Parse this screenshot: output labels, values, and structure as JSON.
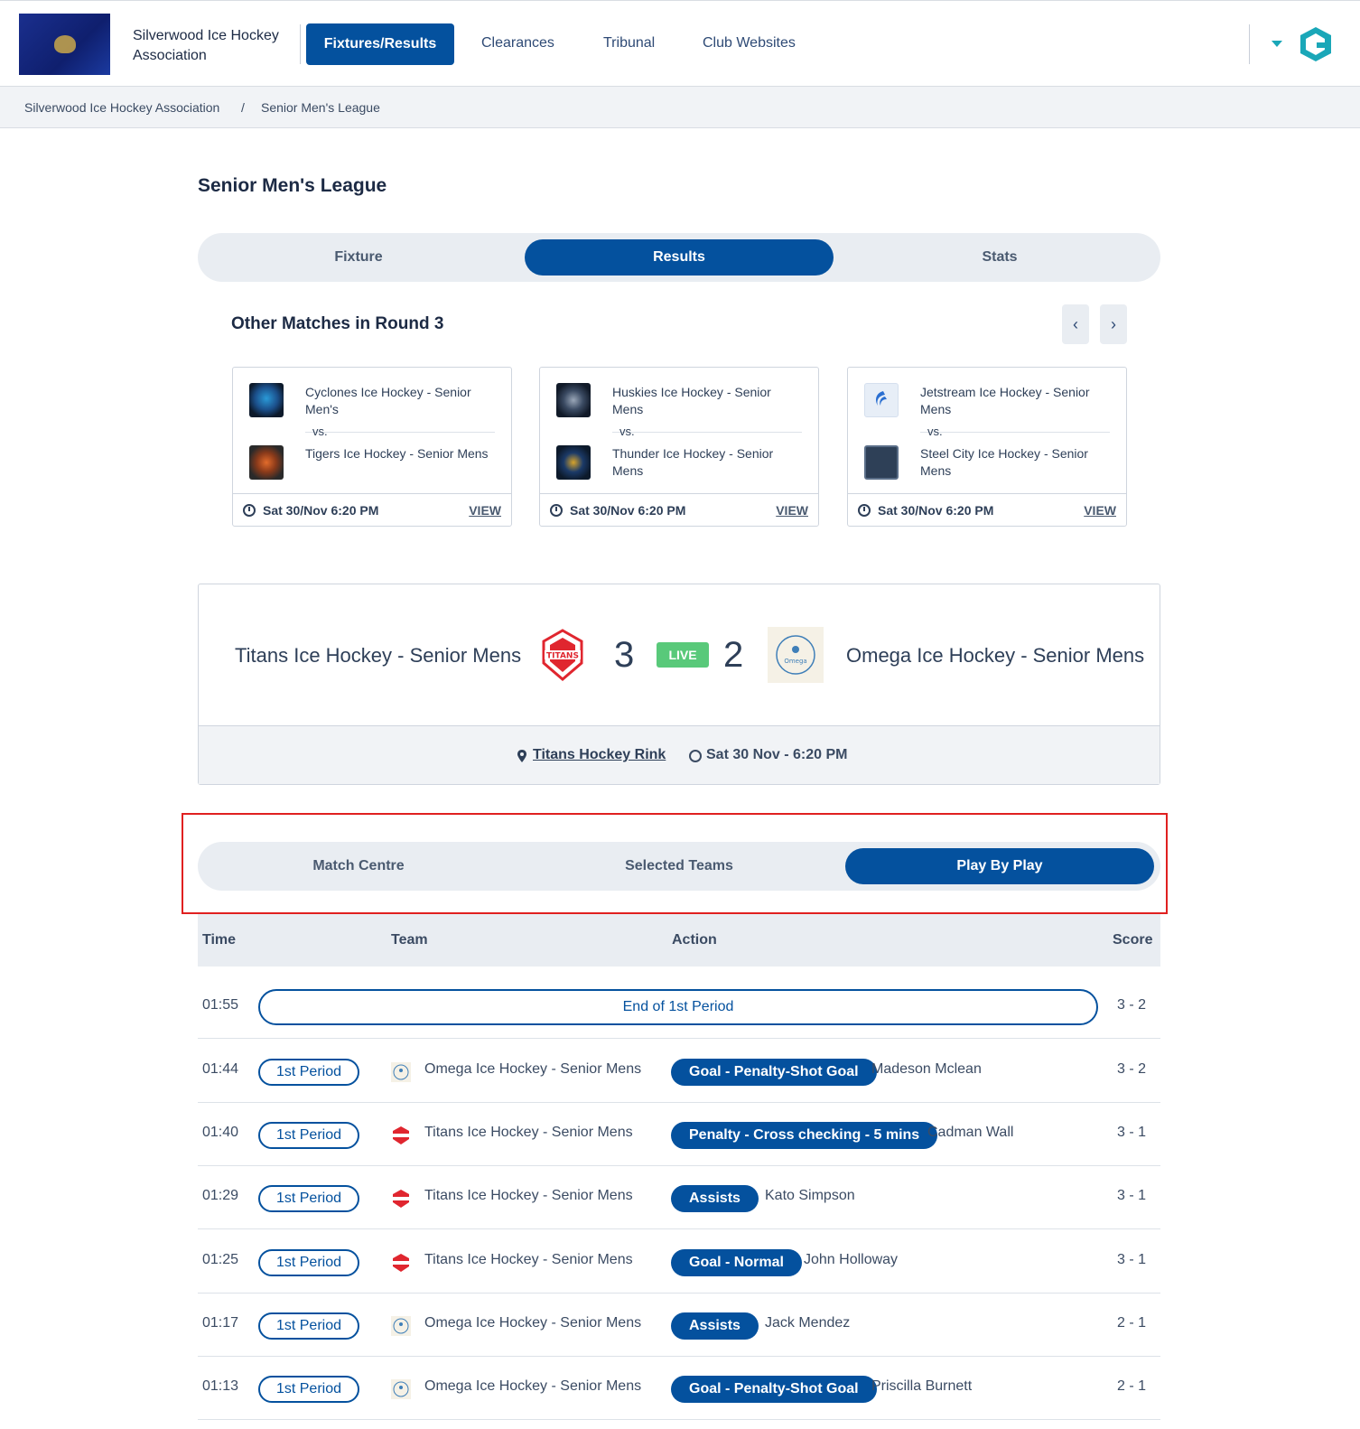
{
  "header": {
    "org_name": "Silverwood Ice Hockey Association",
    "nav": [
      "Fixtures/Results",
      "Clearances",
      "Tribunal",
      "Club Websites"
    ]
  },
  "breadcrumb": [
    "Silverwood Ice Hockey Association",
    "/",
    "Senior Men's League"
  ],
  "page_title": "Senior Men's League",
  "main_tabs": [
    "Fixture",
    "Results",
    "Stats"
  ],
  "other_matches": {
    "heading": "Other Matches in Round 3",
    "matches": [
      {
        "home": "Cyclones Ice Hockey - Senior Men's",
        "away": "Tigers Ice Hockey - Senior Mens",
        "vs": "vs.",
        "when": "Sat 30/Nov 6:20 PM",
        "view": "VIEW"
      },
      {
        "home": "Huskies Ice Hockey - Senior Mens",
        "away": "Thunder Ice Hockey - Senior Mens",
        "vs": "vs.",
        "when": "Sat 30/Nov 6:20 PM",
        "view": "VIEW"
      },
      {
        "home": "Jetstream Ice Hockey - Senior Mens",
        "away": "Steel City Ice Hockey - Senior Mens",
        "vs": "vs.",
        "when": "Sat 30/Nov 6:20 PM",
        "view": "VIEW"
      }
    ]
  },
  "scoreboard": {
    "home": "Titans Ice Hockey - Senior Mens",
    "home_score": "3",
    "status": "LIVE",
    "away_score": "2",
    "away": "Omega Ice Hockey - Senior Mens",
    "venue": "Titans Hockey Rink",
    "datetime": "Sat 30 Nov - 6:20 PM"
  },
  "match_tabs": [
    "Match Centre",
    "Selected Teams",
    "Play By Play"
  ],
  "pbp": {
    "columns": [
      "Time",
      "Team",
      "Action",
      "Score"
    ],
    "banner": {
      "time": "01:55",
      "text": "End of 1st Period",
      "score": "3 - 2"
    },
    "rows": [
      {
        "time": "01:44",
        "period": "1st Period",
        "team": "Omega Ice Hockey - Senior Mens",
        "action": "Goal - Penalty-Shot Goal",
        "player": "Madeson Mclean",
        "score": "3 - 2"
      },
      {
        "time": "01:40",
        "period": "1st Period",
        "team": "Titans Ice Hockey - Senior Mens",
        "action": "Penalty - Cross checking - 5 mins",
        "player": "Cadman Wall",
        "score": "3 - 1"
      },
      {
        "time": "01:29",
        "period": "1st Period",
        "team": "Titans Ice Hockey - Senior Mens",
        "action": "Assists",
        "player": "Kato Simpson",
        "score": "3 - 1"
      },
      {
        "time": "01:25",
        "period": "1st Period",
        "team": "Titans Ice Hockey - Senior Mens",
        "action": "Goal - Normal",
        "player": "John Holloway",
        "score": "3 - 1"
      },
      {
        "time": "01:17",
        "period": "1st Period",
        "team": "Omega Ice Hockey - Senior Mens",
        "action": "Assists",
        "player": "Jack Mendez",
        "score": "2 - 1"
      },
      {
        "time": "01:13",
        "period": "1st Period",
        "team": "Omega Ice Hockey - Senior Mens",
        "action": "Goal - Penalty-Shot Goal",
        "player": "Priscilla Burnett",
        "score": "2 - 1"
      }
    ]
  },
  "colors": {
    "primary": "#04519e",
    "live": "#59c97a",
    "highlight": "#e02020",
    "brand": "#1aa7b8"
  }
}
